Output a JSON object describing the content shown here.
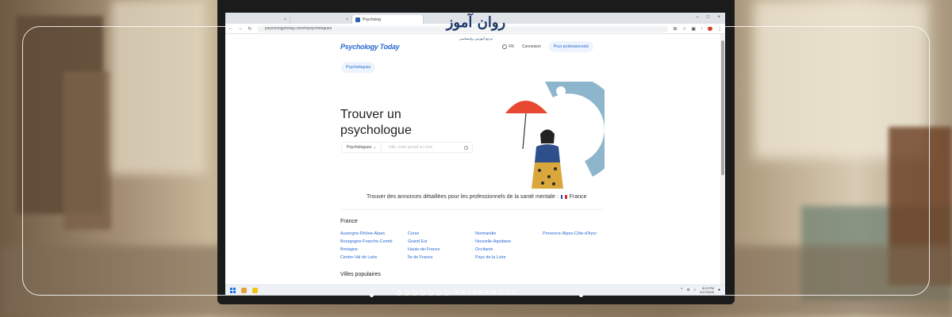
{
  "browser": {
    "tabs": [
      {
        "label": ""
      },
      {
        "label": ""
      },
      {
        "label": "Psycholog"
      }
    ],
    "url": "psychologytoday.com/fr/psychologues"
  },
  "site": {
    "logo": "Psychology Today",
    "lang": "FR",
    "login": "Connexion",
    "pro_button": "Pour professionnels",
    "pill": "Psychologues",
    "hero_title": "Trouver un psychologue",
    "search": {
      "select_value": "Psychologues",
      "placeholder": "Ville, code postal ou nom"
    },
    "tagline": "Trouver des annonces détaillées pour les professionnels de la santé mentale :",
    "country": "France",
    "section_title": "France",
    "regions": [
      [
        "Auvergne-Rhône-Alpes",
        "Corse",
        "Normandie",
        "Provence-Alpes-Côte-d'Azur"
      ],
      [
        "Bourgogne-Franche-Comté",
        "Grand Est",
        "Nouvelle-Aquitaine",
        ""
      ],
      [
        "Bretagne",
        "Hauts-de-France",
        "Occitanie",
        ""
      ],
      [
        "Centre-Val de Loire",
        "Île de France",
        "Pays de la Loire",
        ""
      ]
    ],
    "section_title_2": "Villes populaires"
  },
  "taskbar": {
    "time": "8:24 PM",
    "date": "2/27/2025"
  },
  "brand": {
    "name": "روان آموز",
    "sub": "مرجع آموزش روانشناسی",
    "footer": "RAVANAMOOZ"
  },
  "colors": {
    "accent": "#2a6bd1",
    "brand": "#1f3a68"
  }
}
